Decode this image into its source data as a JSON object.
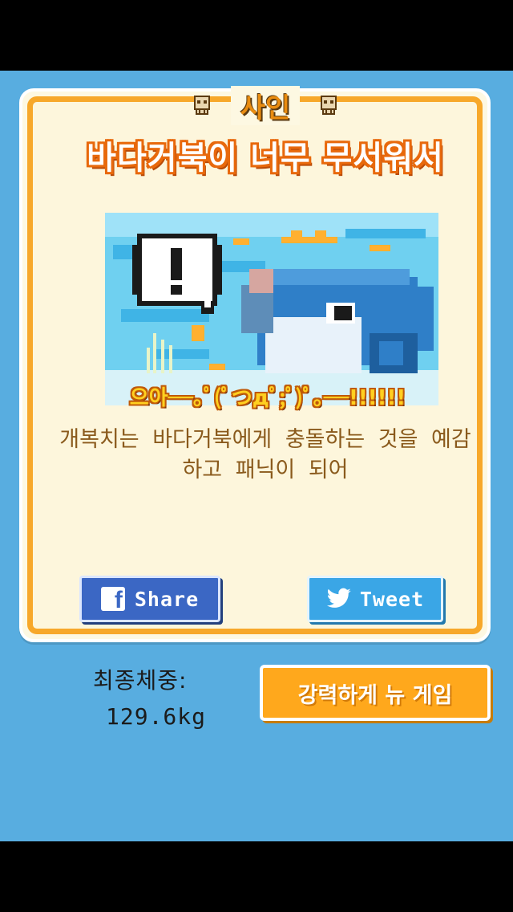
{
  "result": {
    "cause_label": "사인",
    "death_title": "바다거북이 너무 무서워서",
    "scream_text": "으아──｡ﾟ(ﾟつдﾟ;ﾟ)ﾟ｡──!!!!!!",
    "description": "개복치는 바다거북에게 충돌하는 것을 예감하고 패닉이 되어",
    "icons": [
      "skull-icon",
      "exclamation-bubble-icon"
    ]
  },
  "share": {
    "facebook_label": "Share",
    "twitter_label": "Tweet",
    "facebook_color": "#3b67c4",
    "twitter_color": "#3aa6e6"
  },
  "stats": {
    "final_weight_label": "최종체중:",
    "final_weight_value": "129.6kg"
  },
  "actions": {
    "new_game_label": "강력하게 뉴 게임"
  },
  "colors": {
    "background": "#58ade0",
    "card_border": "#f7a82a",
    "title_outline": "#e8690c",
    "button_orange": "#ffa81c"
  }
}
